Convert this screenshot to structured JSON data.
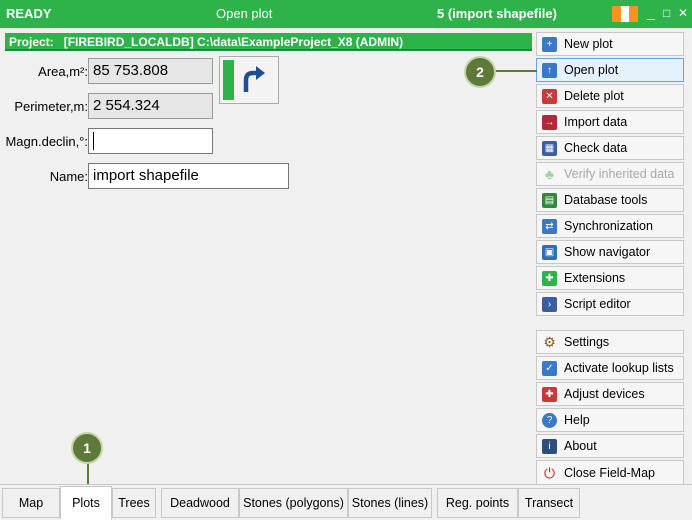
{
  "titlebar": {
    "status": "READY",
    "center": "Open plot",
    "right": "5 (import shapefile)",
    "flag_colors": [
      "#f7931e",
      "#ffffff",
      "#f7931e"
    ],
    "minimize": "_",
    "maximize": "□",
    "close": "✕"
  },
  "project": {
    "label": "Project:",
    "text": "[FIREBIRD_LOCALDB] C:\\data\\ExampleProject_X8   (ADMIN)"
  },
  "fields": {
    "area": {
      "label": "Area,m²:",
      "value": "85 753.808"
    },
    "perimeter": {
      "label": "Perimeter,m:",
      "value": "2 554.324"
    },
    "magn": {
      "label": "Magn.declin,°:",
      "value": ""
    },
    "name": {
      "label": "Name:",
      "value": "import shapefile"
    }
  },
  "sidebar": {
    "items": [
      {
        "label": "New plot",
        "icon": "new-plot-icon",
        "color": "#3a78c8"
      },
      {
        "label": "Open plot",
        "icon": "open-plot-icon",
        "color": "#3a78c8"
      },
      {
        "label": "Delete plot",
        "icon": "delete-plot-icon",
        "color": "#c83a3a"
      },
      {
        "label": "Import data",
        "icon": "import-data-icon",
        "color": "#b0283a"
      },
      {
        "label": "Check data",
        "icon": "check-data-icon",
        "color": "#3a5fa0"
      },
      {
        "label": "Verify inherited data",
        "icon": "tree-icon",
        "color": "#9fd39f"
      },
      {
        "label": "Database tools",
        "icon": "database-tools-icon",
        "color": "#2e8b3a"
      },
      {
        "label": "Synchronization",
        "icon": "sync-icon",
        "color": "#3a78c8"
      },
      {
        "label": "Show navigator",
        "icon": "navigator-icon",
        "color": "#2a6fb8"
      },
      {
        "label": "Extensions",
        "icon": "extensions-icon",
        "color": "#2db34a"
      },
      {
        "label": "Script editor",
        "icon": "script-editor-icon",
        "color": "#3a5fa0"
      },
      {
        "label": "Settings",
        "icon": "gear-icon",
        "color": "#8a5a2a"
      },
      {
        "label": "Activate lookup lists",
        "icon": "lookup-lists-icon",
        "color": "#3a78c8"
      },
      {
        "label": "Adjust devices",
        "icon": "devices-icon",
        "color": "#c83a3a"
      },
      {
        "label": "Help",
        "icon": "help-icon",
        "color": "#3a78c8"
      },
      {
        "label": "About",
        "icon": "info-icon",
        "color": "#2a4f80"
      },
      {
        "label": "Close Field-Map",
        "icon": "power-icon",
        "color": "#d02020"
      }
    ]
  },
  "callouts": {
    "one": "1",
    "two": "2"
  },
  "tabs": [
    {
      "label": "Map"
    },
    {
      "label": "Plots"
    },
    {
      "label": "Trees"
    },
    {
      "label": "Deadwood"
    },
    {
      "label": "Stones (polygons)"
    },
    {
      "label": "Stones (lines)"
    },
    {
      "label": "Reg. points"
    },
    {
      "label": "Transect"
    }
  ]
}
